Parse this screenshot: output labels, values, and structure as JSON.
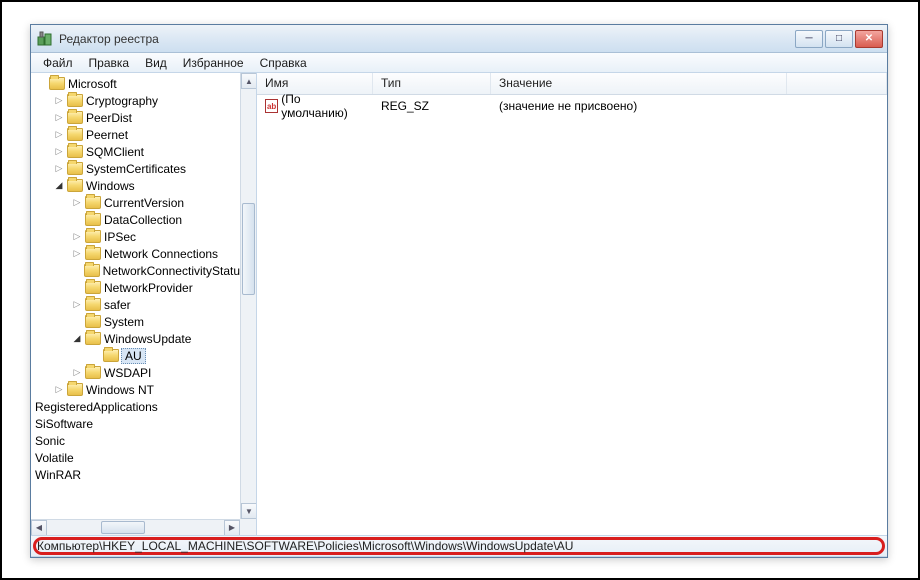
{
  "window": {
    "title": "Редактор реестра"
  },
  "menu": {
    "file": "Файл",
    "edit": "Правка",
    "view": "Вид",
    "favorites": "Избранное",
    "help": "Справка"
  },
  "tree": {
    "root": "Microsoft",
    "items": [
      "Cryptography",
      "PeerDist",
      "Peernet",
      "SQMClient",
      "SystemCertificates"
    ],
    "windows": "Windows",
    "windows_items": [
      "CurrentVersion",
      "DataCollection",
      "IPSec",
      "Network Connections",
      "NetworkConnectivityStatu",
      "NetworkProvider",
      "safer",
      "System"
    ],
    "windowsupdate": "WindowsUpdate",
    "au": "AU",
    "wsdapi": "WSDAPI",
    "windowsnt": "Windows NT",
    "tail": [
      "RegisteredApplications",
      "SiSoftware",
      "Sonic",
      "Volatile",
      "WinRAR"
    ]
  },
  "columns": {
    "name": "Имя",
    "type": "Тип",
    "value": "Значение"
  },
  "list": {
    "row0": {
      "name": "(По умолчанию)",
      "type": "REG_SZ",
      "value": "(значение не присвоено)"
    }
  },
  "statusbar": {
    "path": "Компьютер\\HKEY_LOCAL_MACHINE\\SOFTWARE\\Policies\\Microsoft\\Windows\\WindowsUpdate\\AU"
  }
}
